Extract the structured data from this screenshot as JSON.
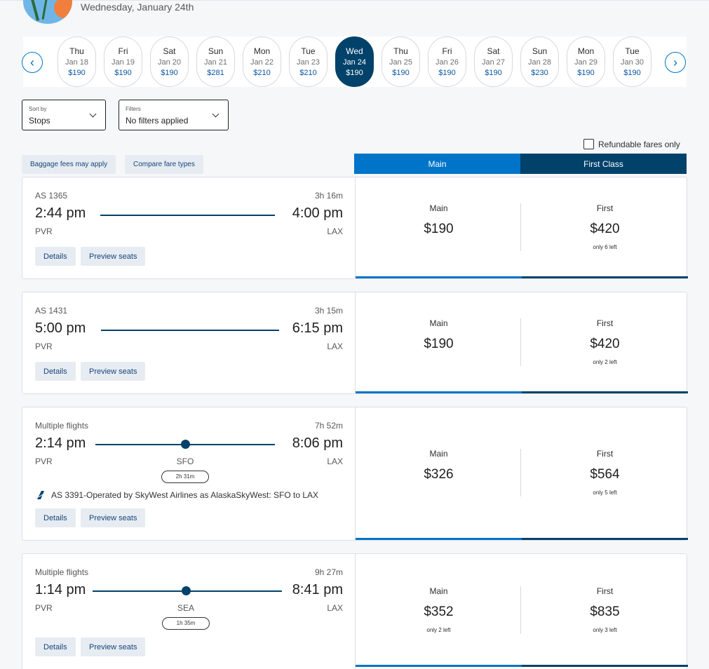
{
  "header": {
    "date": "Wednesday, January 24th"
  },
  "date_strip": {
    "days": [
      {
        "dow": "Thu",
        "date": "Jan 18",
        "price": "$190"
      },
      {
        "dow": "Fri",
        "date": "Jan 19",
        "price": "$190"
      },
      {
        "dow": "Sat",
        "date": "Jan 20",
        "price": "$190"
      },
      {
        "dow": "Sun",
        "date": "Jan 21",
        "price": "$281"
      },
      {
        "dow": "Mon",
        "date": "Jan 22",
        "price": "$210"
      },
      {
        "dow": "Tue",
        "date": "Jan 23",
        "price": "$210"
      },
      {
        "dow": "Wed",
        "date": "Jan 24",
        "price": "$190"
      },
      {
        "dow": "Thu",
        "date": "Jan 25",
        "price": "$190"
      },
      {
        "dow": "Fri",
        "date": "Jan 26",
        "price": "$190"
      },
      {
        "dow": "Sat",
        "date": "Jan 27",
        "price": "$190"
      },
      {
        "dow": "Sun",
        "date": "Jan 28",
        "price": "$230"
      },
      {
        "dow": "Mon",
        "date": "Jan 29",
        "price": "$190"
      },
      {
        "dow": "Tue",
        "date": "Jan 30",
        "price": "$190"
      }
    ],
    "selected_index": 6,
    "prev_icon": "‹",
    "next_icon": "›"
  },
  "filters": {
    "sort": {
      "label": "Sort by",
      "value": "Stops"
    },
    "filter": {
      "label": "Filters",
      "value": "No filters applied"
    },
    "refundable_label": "Refundable fares only"
  },
  "actions": {
    "baggage": "Baggage fees may apply",
    "compare": "Compare fare types"
  },
  "tabs": {
    "main": "Main",
    "first": "First Class"
  },
  "flights": [
    {
      "flight": "AS 1365",
      "duration": "3h 16m",
      "depart": "2:44 pm",
      "arrive": "4:00 pm",
      "from": "PVR",
      "to": "LAX",
      "main_label": "Main",
      "main_price": "$190",
      "main_left": "",
      "first_label": "First",
      "first_price": "$420",
      "first_left": "only 6 left",
      "details": "Details",
      "preview": "Preview seats"
    },
    {
      "flight": "AS 1431",
      "duration": "3h 15m",
      "depart": "5:00 pm",
      "arrive": "6:15 pm",
      "from": "PVR",
      "to": "LAX",
      "main_label": "Main",
      "main_price": "$190",
      "main_left": "",
      "first_label": "First",
      "first_price": "$420",
      "first_left": "only 2 left",
      "details": "Details",
      "preview": "Preview seats"
    },
    {
      "flight": "Multiple flights",
      "duration": "7h 52m",
      "depart": "2:14 pm",
      "arrive": "8:06 pm",
      "from": "PVR",
      "to": "LAX",
      "stop": "SFO",
      "layover": "2h 31m",
      "operated": "AS 3391-Operated by SkyWest Airlines as AlaskaSkyWest: SFO to LAX",
      "main_label": "Main",
      "main_price": "$326",
      "main_left": "",
      "first_label": "First",
      "first_price": "$564",
      "first_left": "only 5 left",
      "details": "Details",
      "preview": "Preview seats"
    },
    {
      "flight": "Multiple flights",
      "duration": "9h 27m",
      "depart": "1:14 pm",
      "arrive": "8:41 pm",
      "from": "PVR",
      "to": "LAX",
      "stop": "SEA",
      "layover": "1h 35m",
      "main_label": "Main",
      "main_price": "$352",
      "main_left": "only 2 left",
      "first_label": "First",
      "first_price": "$835",
      "first_left": "only 3 left",
      "details": "Details",
      "preview": "Preview seats"
    }
  ],
  "colors": {
    "accent": "#0074c8",
    "navy": "#01426a",
    "background": "#f6f7f9"
  }
}
